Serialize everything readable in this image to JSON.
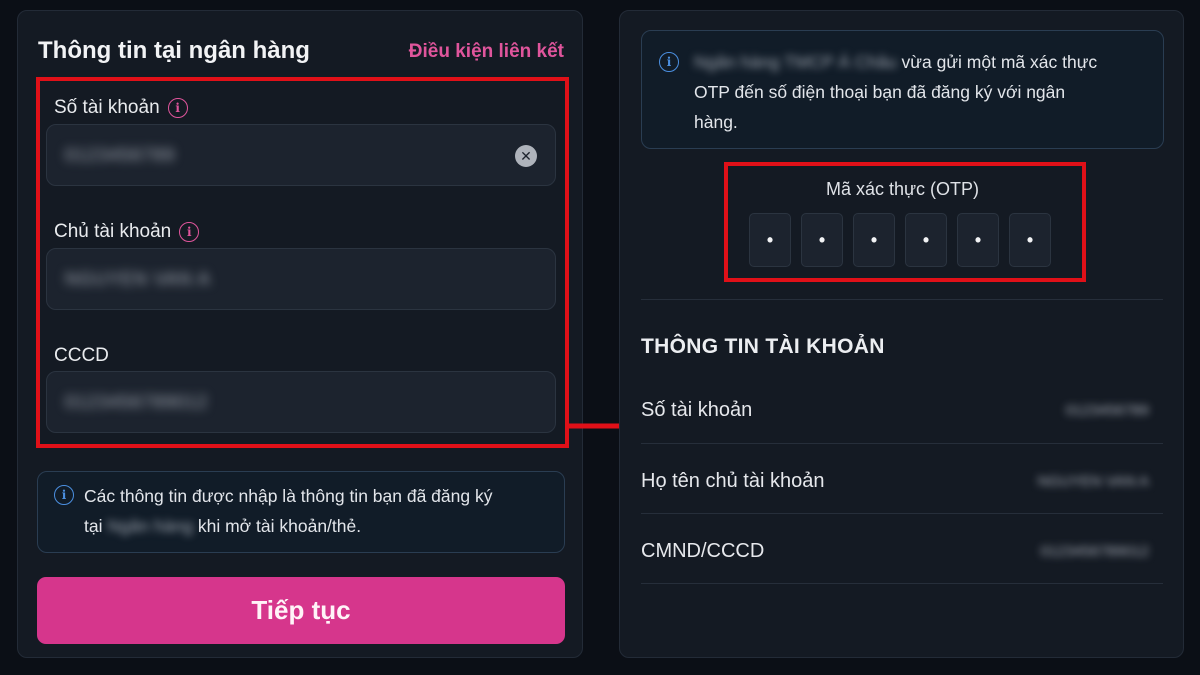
{
  "left": {
    "title": "Thông tin tại ngân hàng",
    "terms_link": "Điều kiện liên kết",
    "fields": [
      {
        "label": "Số tài khoản",
        "value": "0123456789"
      },
      {
        "label": "Chủ tài khoản",
        "value": "NGUYEN VAN A"
      },
      {
        "label": "CCCD",
        "value": "0123456789012"
      }
    ],
    "note": {
      "line1": "Các thông tin được nhập là thông tin bạn đã đăng ký",
      "line2_prefix": "tại",
      "bank_name": "Ngân hàng",
      "line2_suffix": "khi mở tài khoản/thẻ."
    },
    "continue_label": "Tiếp tục"
  },
  "right": {
    "note": {
      "sender": "Ngân hàng TMCP Á Châu",
      "line1": "vừa gửi một mã xác thực",
      "line2": "OTP đến số điện thoại bạn đã đăng ký với ngân",
      "line3": "hàng."
    },
    "otp_label": "Mã xác thực (OTP)",
    "otp_digits": [
      "•",
      "•",
      "•",
      "•",
      "•",
      "•"
    ],
    "account_heading": "THÔNG TIN TÀI KHOẢN",
    "rows": [
      {
        "label": "Số tài khoản",
        "value": "0123456789"
      },
      {
        "label": "Họ tên chủ tài khoản",
        "value": "NGUYEN VAN A"
      },
      {
        "label": "CMND/CCCD",
        "value": "0123456789012"
      }
    ]
  },
  "colors": {
    "accent_pink": "#d6368c",
    "highlight_red": "#e01018",
    "info_blue": "#4b8fe0"
  }
}
